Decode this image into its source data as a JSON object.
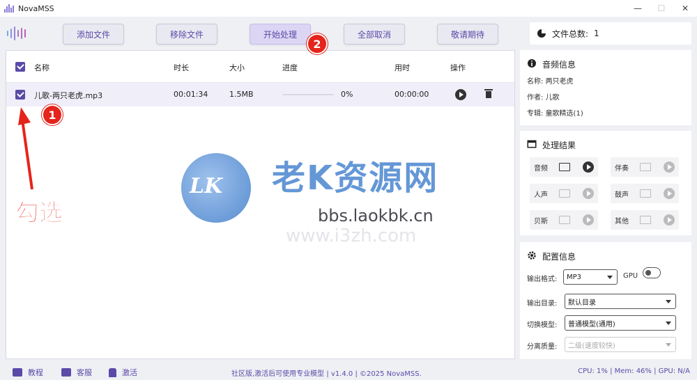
{
  "window": {
    "title": "NovaMSS",
    "minimize": "—",
    "maximize": "☐",
    "close": "✕"
  },
  "toolbar": {
    "add_files": "添加文件",
    "remove_files": "移除文件",
    "start_processing": "开始处理",
    "cancel_all": "全部取消",
    "coming_soon": "敬请期待"
  },
  "file_count": {
    "label": "文件总数:",
    "value": "1"
  },
  "table": {
    "headers": {
      "name": "名称",
      "duration": "时长",
      "size": "大小",
      "progress": "进度",
      "elapsed": "用时",
      "actions": "操作"
    },
    "rows": [
      {
        "name": "儿歌-两只老虎.mp3",
        "duration": "00:01:34",
        "size": "1.5MB",
        "progress_text": "0%",
        "progress_value": 0,
        "elapsed": "00:00:00"
      }
    ]
  },
  "watermark": {
    "badge": "LK",
    "title": "老K资源网",
    "url": "bbs.laokbk.cn",
    "url2": "www.i3zh.com"
  },
  "annotations": {
    "step1": "1",
    "step2": "2",
    "label": "勾选"
  },
  "audio_info": {
    "title": "音频信息",
    "name_label": "名称:",
    "name_value": "两只老虎",
    "author_label": "作者:",
    "author_value": "儿歌",
    "album_label": "专辑:",
    "album_value": "童歌精选(1)"
  },
  "results": {
    "title": "处理结果",
    "items": [
      {
        "label": "音频",
        "active": true
      },
      {
        "label": "伴奏",
        "active": false
      },
      {
        "label": "人声",
        "active": false
      },
      {
        "label": "鼓声",
        "active": false
      },
      {
        "label": "贝斯",
        "active": false
      },
      {
        "label": "其他",
        "active": false
      }
    ]
  },
  "config": {
    "title": "配置信息",
    "format_label": "输出格式:",
    "format_value": "MP3",
    "gpu_label": "GPU",
    "dir_label": "输出目录:",
    "dir_value": "默认目录",
    "model_label": "切换模型:",
    "model_value": "普通模型(通用)",
    "quality_label": "分离质量:",
    "quality_value": "二级(速度较快)"
  },
  "statusbar": {
    "tutorial": "教程",
    "support": "客服",
    "activate": "激活",
    "center": "社区版,激活后可使用专业模型 | v1.4.0 | ©2025 NovaMSS.",
    "right": "CPU: 1% | Mem: 46% | GPU: N/A"
  },
  "colors": {
    "accent": "#5b4aa8",
    "annotation": "#e5241b",
    "watermark_blue": "#4a86d0"
  }
}
